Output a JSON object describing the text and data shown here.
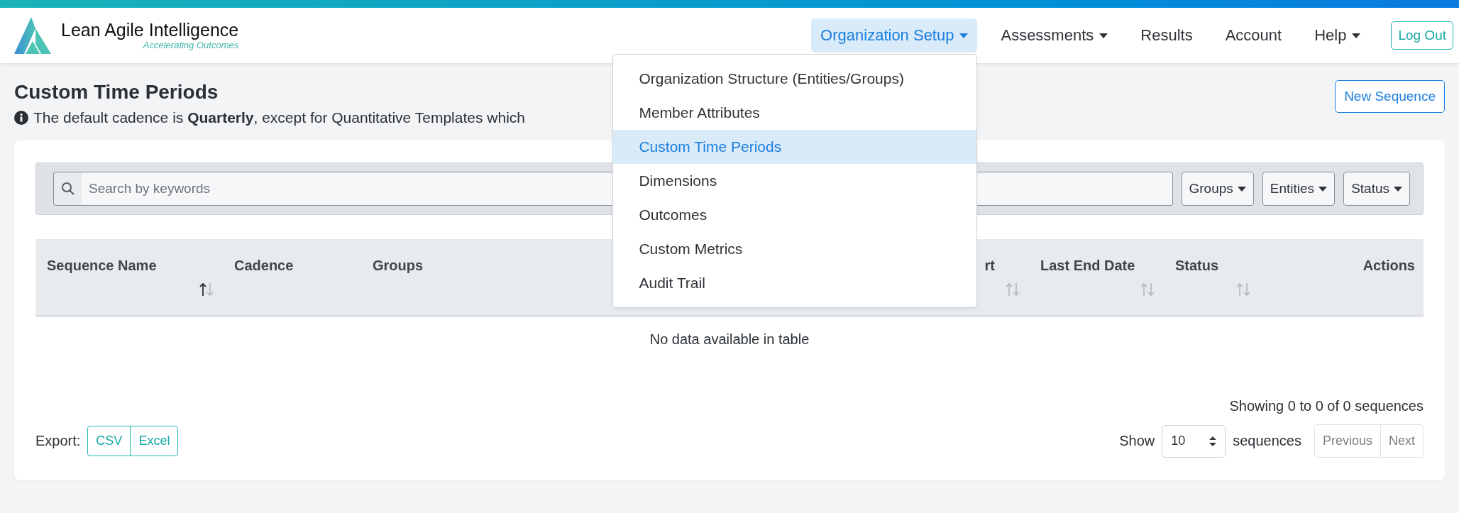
{
  "header": {
    "logo": {
      "title": "Lean Agile Intelligence",
      "tagline": "Accelerating Outcomes"
    },
    "nav": [
      {
        "label": "Organization Setup",
        "dropdown": true,
        "selected": true
      },
      {
        "label": "Assessments",
        "dropdown": true,
        "selected": false
      },
      {
        "label": "Results",
        "dropdown": false,
        "selected": false
      },
      {
        "label": "Account",
        "dropdown": false,
        "selected": false
      },
      {
        "label": "Help",
        "dropdown": true,
        "selected": false
      }
    ],
    "logout": "Log Out"
  },
  "menu": {
    "items": [
      {
        "label": "Organization Structure (Entities/Groups)",
        "selected": false
      },
      {
        "label": "Member Attributes",
        "selected": false
      },
      {
        "label": "Custom Time Periods",
        "selected": true
      },
      {
        "label": "Dimensions",
        "selected": false
      },
      {
        "label": "Outcomes",
        "selected": false
      },
      {
        "label": "Custom Metrics",
        "selected": false
      },
      {
        "label": "Audit Trail",
        "selected": false
      }
    ]
  },
  "page": {
    "title": "Custom Time Periods",
    "info": "The default cadence is **Quarterly**, except for Quantitative Templates which",
    "new_button": "New Sequence"
  },
  "filters": {
    "search": {
      "placeholder": "Search by keywords"
    },
    "buttons": [
      "Groups",
      "Entities",
      "Status"
    ]
  },
  "table": {
    "columns": [
      {
        "label": "Sequence Name",
        "sortable": true,
        "sorted": true
      },
      {
        "label": "Cadence",
        "sortable": false
      },
      {
        "label": "Groups",
        "sortable": false
      },
      {
        "label": "rt",
        "sortable": true,
        "sorted": false
      },
      {
        "label": "Last End Date",
        "sortable": true,
        "sorted": false
      },
      {
        "label": "Status",
        "sortable": true,
        "sorted": false
      },
      {
        "label": "Actions",
        "sortable": false
      }
    ],
    "empty": "No data available in table"
  },
  "footer": {
    "info": "Showing 0 to 0 of 0 sequences",
    "export_label": "Export:",
    "export_buttons": [
      "CSV",
      "Excel"
    ],
    "show_label": "Show",
    "page_size": "10",
    "show_suffix": "sequences",
    "pager": [
      {
        "label": "Previous",
        "disabled": true
      },
      {
        "label": "Next",
        "disabled": true
      }
    ]
  }
}
